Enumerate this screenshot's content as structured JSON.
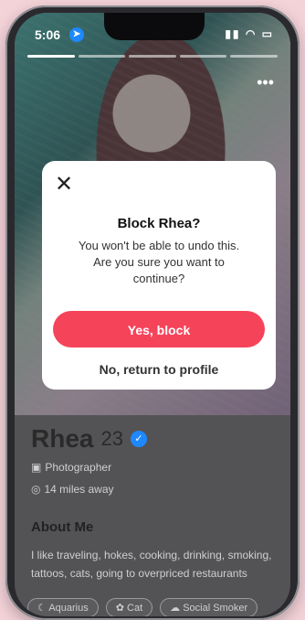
{
  "status_bar": {
    "time": "5:06",
    "location_icon": "arrow",
    "signal_icons": "wifi battery"
  },
  "profile": {
    "name": "Rhea",
    "age": "23",
    "job": "Photographer",
    "distance": "14 miles away",
    "about_heading": "About Me",
    "bio": "I like traveling, hokes, cooking, drinking, smoking, tattoos, cats, going to overpriced restaurants",
    "chips": [
      "Aquarius",
      "Cat",
      "Social Smoker"
    ]
  },
  "modal": {
    "title": "Block Rhea?",
    "message": "You won't be able to undo this.\nAre you sure you want to\ncontinue?",
    "confirm_label": "Yes, block",
    "cancel_label": "No, return to profile"
  },
  "colors": {
    "accent": "#f5435a",
    "verified": "#1e88ff"
  }
}
